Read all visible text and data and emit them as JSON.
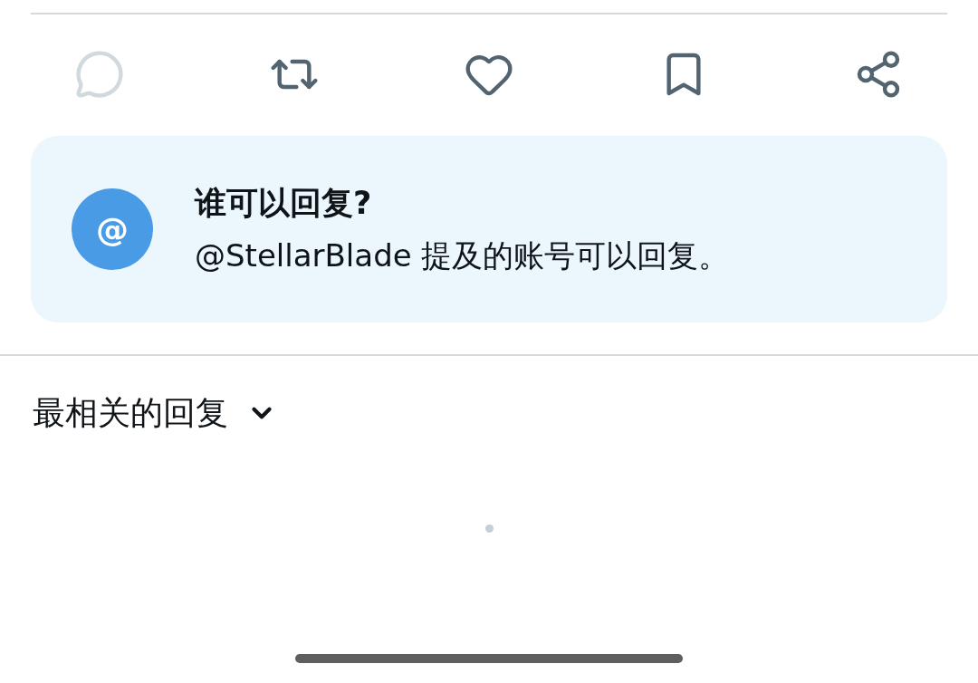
{
  "actions": [
    {
      "kind": "reply",
      "disabled": true
    },
    {
      "kind": "repost",
      "disabled": false
    },
    {
      "kind": "like",
      "disabled": false
    },
    {
      "kind": "bookmark",
      "disabled": false
    },
    {
      "kind": "share",
      "disabled": false
    }
  ],
  "reply_notice": {
    "badge": "@",
    "title": "谁可以回复?",
    "text": "@StellarBlade 提及的账号可以回复。"
  },
  "sort": {
    "label": "最相关的回复"
  },
  "loading": true
}
